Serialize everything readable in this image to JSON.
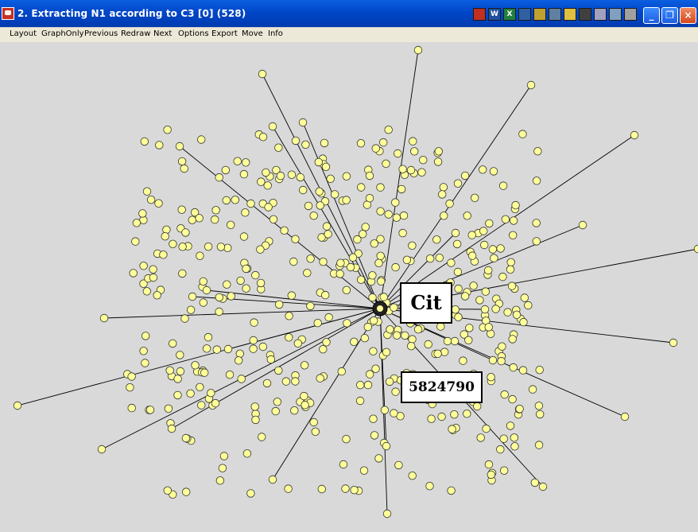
{
  "window": {
    "title": "2. Extracting N1 according to C3 [0] (528)",
    "app_icon": "pajek-draw-icon",
    "controls": {
      "minimize": "_",
      "restore": "❐",
      "close": "×"
    }
  },
  "taskbar_icons": [
    {
      "name": "tray-program-icon-1",
      "color": "#c03020"
    },
    {
      "name": "word-icon",
      "color": "#2050a0",
      "glyph": "W"
    },
    {
      "name": "excel-icon",
      "color": "#208040",
      "glyph": "X"
    },
    {
      "name": "window-icon",
      "color": "#3060a0"
    },
    {
      "name": "search-icon",
      "color": "#c0a030"
    },
    {
      "name": "network-icon",
      "color": "#6080a0"
    },
    {
      "name": "folder-icon",
      "color": "#e0c040"
    },
    {
      "name": "terminal-icon",
      "color": "#404040"
    },
    {
      "name": "document-icon",
      "color": "#a0a0c0"
    },
    {
      "name": "notepad-icon",
      "color": "#80a0c0"
    },
    {
      "name": "document-icon-2",
      "color": "#a0a0a0"
    }
  ],
  "menu": [
    {
      "label": "Layout"
    },
    {
      "label": "GraphOnly"
    },
    {
      "label": "Previous"
    },
    {
      "label": "Redraw"
    },
    {
      "label": "Next"
    },
    {
      "label": "Options"
    },
    {
      "label": "Export"
    },
    {
      "label": "Move"
    },
    {
      "label": "Info"
    }
  ],
  "graph": {
    "node_fill": "#ffff99",
    "node_stroke": "#333333",
    "edge_color": "#000000",
    "background": "#d9d9d9",
    "labels": {
      "center": "Cit",
      "selected_vertex": "5824790"
    }
  }
}
